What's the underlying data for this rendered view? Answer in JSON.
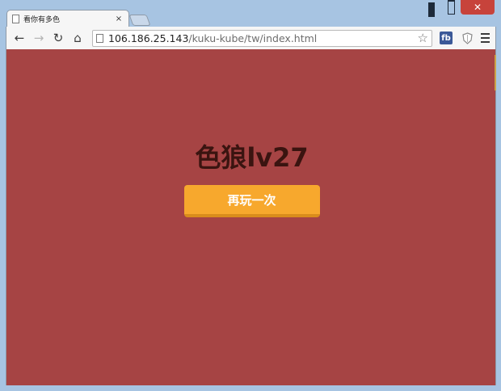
{
  "window": {
    "tab_title": "看你有多色",
    "tab_close": "×",
    "close_glyph": "✕"
  },
  "toolbar": {
    "back_icon": "←",
    "forward_icon": "→",
    "reload_icon": "↻",
    "home_icon": "⌂",
    "url_host": "106.186.25.143",
    "url_path": "/kuku-kube/tw/index.html",
    "star_icon": "☆",
    "fb_label": "fb"
  },
  "game": {
    "result_text": "色狼lv27",
    "replay_label": "再玩一次"
  },
  "colors": {
    "background": "#a64444",
    "button": "#f7a82d",
    "result_text": "#3a1410"
  }
}
